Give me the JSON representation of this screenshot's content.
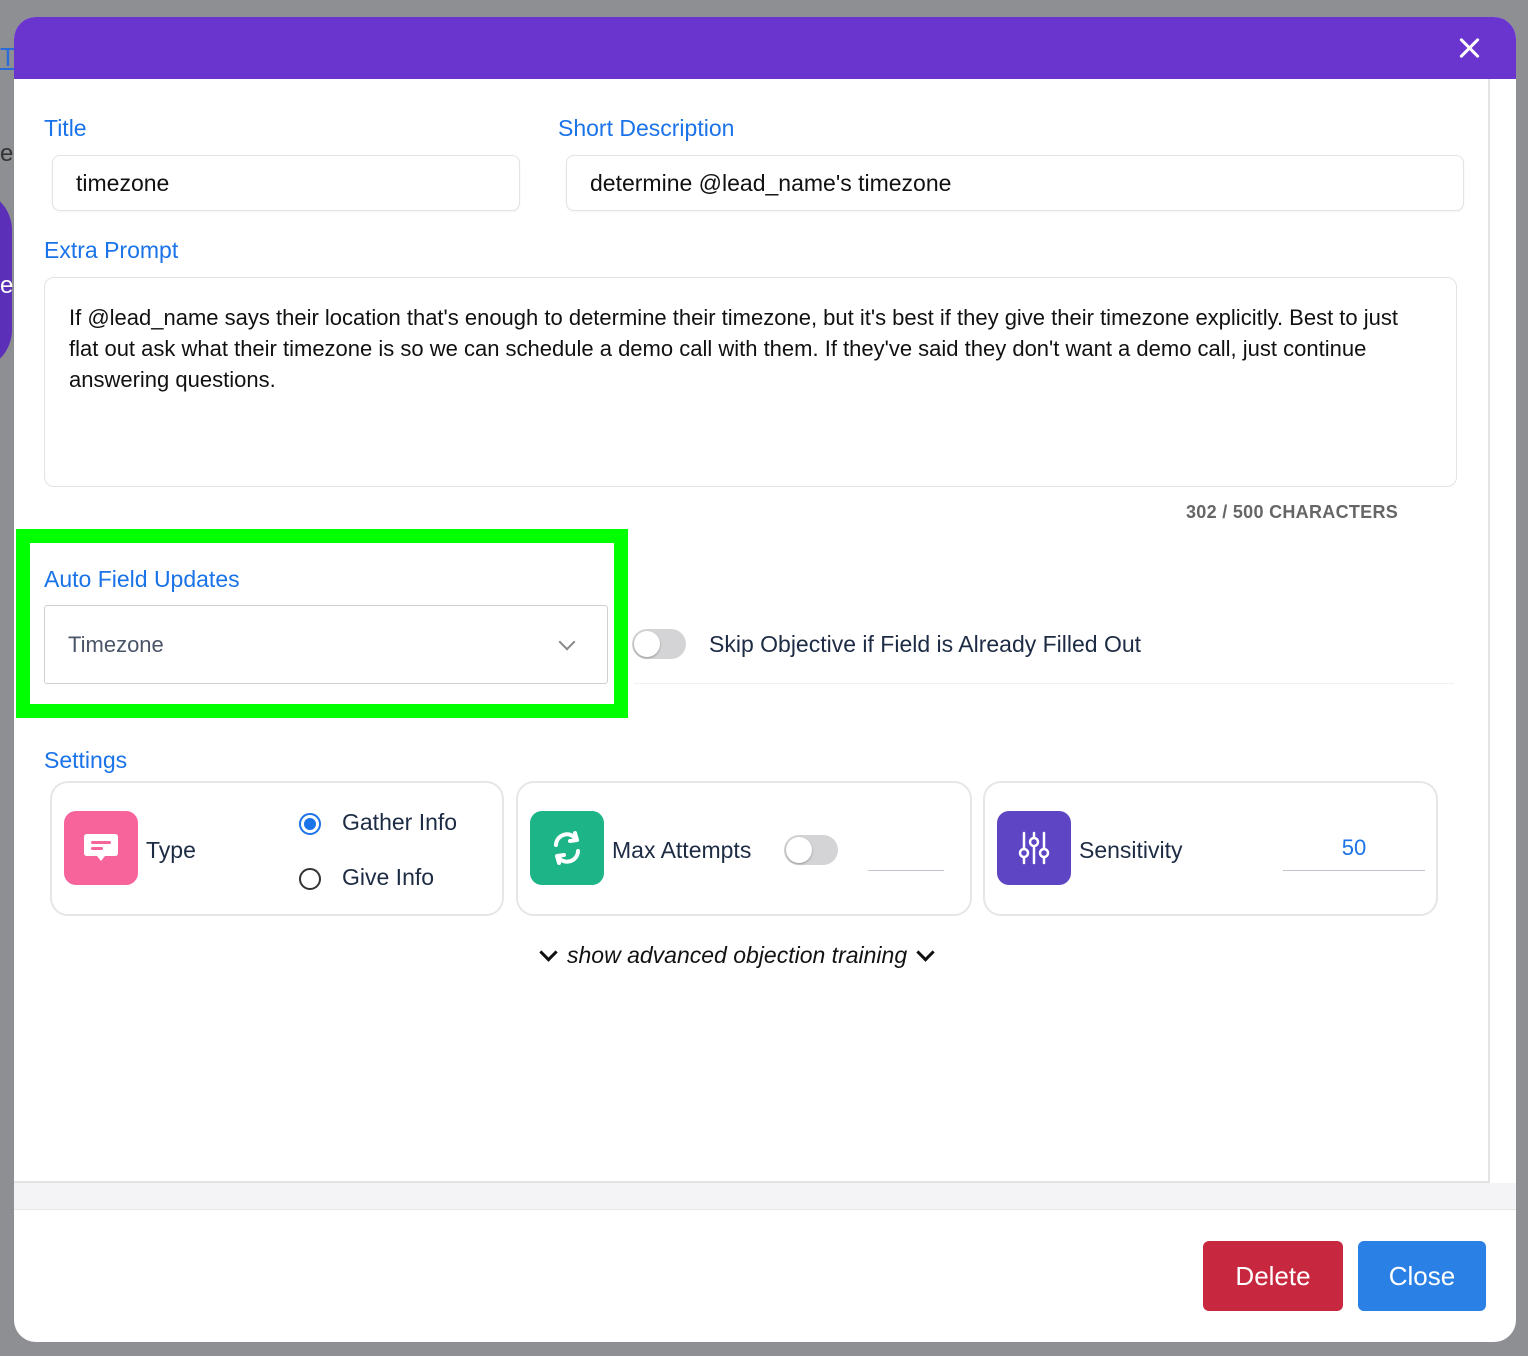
{
  "background": {
    "link_fragment": "T",
    "text_fragment_1": "er",
    "text_fragment_2": "e"
  },
  "form": {
    "title_label": "Title",
    "title_value": "timezone",
    "short_desc_label": "Short Description",
    "short_desc_value": "determine @lead_name's timezone",
    "extra_prompt_label": "Extra Prompt",
    "extra_prompt_value": "If @lead_name says their location that's enough to determine their timezone, but it's best if they give their timezone explicitly.  Best to just flat out ask what their timezone is so we can schedule a demo call with them.  If they've said they don't want a demo call, just continue answering questions.",
    "char_count": "302 / 500 CHARACTERS",
    "auto_field_label": "Auto Field Updates",
    "auto_field_value": "Timezone",
    "skip_label": "Skip Objective if Field is Already Filled Out",
    "skip_toggle_on": false
  },
  "settings": {
    "label": "Settings",
    "type_label": "Type",
    "type_options": [
      "Gather Info",
      "Give Info"
    ],
    "type_selected": "Gather Info",
    "max_attempts_label": "Max Attempts",
    "max_attempts_toggle_on": false,
    "max_attempts_value": "",
    "sensitivity_label": "Sensitivity",
    "sensitivity_value": "50"
  },
  "advanced_link": "show advanced objection training",
  "buttons": {
    "delete": "Delete",
    "close": "Close"
  },
  "colors": {
    "header": "#6a35cf",
    "accent": "#1a73e8",
    "highlight": "#00ff00",
    "type_icon_bg": "#f7649b",
    "attempts_icon_bg": "#1db488",
    "sensitivity_icon_bg": "#5d45c4",
    "delete_bg": "#c8283f",
    "close_bg": "#2b80e6"
  },
  "icons": {
    "header_close": "close-icon",
    "type": "chat-message-icon",
    "max_attempts": "refresh-icon",
    "sensitivity": "sliders-icon",
    "dropdown": "chevron-down-icon"
  }
}
